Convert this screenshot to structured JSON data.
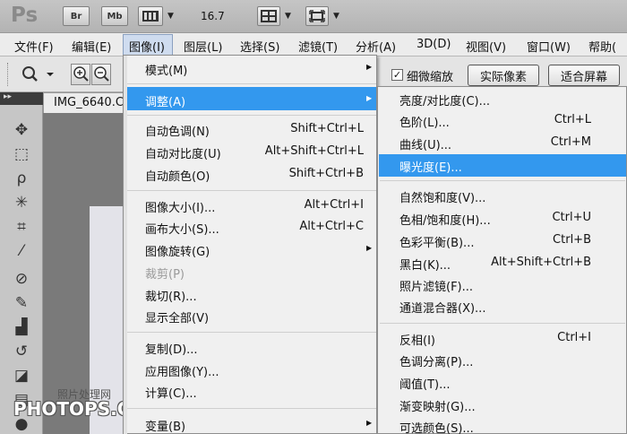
{
  "app": {
    "logo": "Ps",
    "toolbar": {
      "br": "Br",
      "mb": "Mb",
      "zoom": "16.7"
    }
  },
  "menubar": {
    "items": [
      {
        "label": "文件(F)"
      },
      {
        "label": "编辑(E)"
      },
      {
        "label": "图像(I)"
      },
      {
        "label": "图层(L)"
      },
      {
        "label": "选择(S)"
      },
      {
        "label": "滤镜(T)"
      },
      {
        "label": "分析(A)"
      },
      {
        "label": "3D(D)"
      },
      {
        "label": "视图(V)"
      },
      {
        "label": "窗口(W)"
      },
      {
        "label": "帮助("
      }
    ]
  },
  "options": {
    "scrubby_zoom": "细微缩放",
    "actual_pixels": "实际像素",
    "fit_screen": "适合屏幕",
    "checked": "✓"
  },
  "document": {
    "tab": "IMG_6640.C"
  },
  "image_menu": {
    "items": [
      {
        "label": "模式(M)",
        "shortcut": ""
      },
      {
        "label": "调整(A)",
        "shortcut": ""
      },
      {
        "label": "自动色调(N)",
        "shortcut": "Shift+Ctrl+L"
      },
      {
        "label": "自动对比度(U)",
        "shortcut": "Alt+Shift+Ctrl+L"
      },
      {
        "label": "自动颜色(O)",
        "shortcut": "Shift+Ctrl+B"
      },
      {
        "label": "图像大小(I)...",
        "shortcut": "Alt+Ctrl+I"
      },
      {
        "label": "画布大小(S)...",
        "shortcut": "Alt+Ctrl+C"
      },
      {
        "label": "图像旋转(G)",
        "shortcut": ""
      },
      {
        "label": "裁剪(P)",
        "shortcut": ""
      },
      {
        "label": "裁切(R)...",
        "shortcut": ""
      },
      {
        "label": "显示全部(V)",
        "shortcut": ""
      },
      {
        "label": "复制(D)...",
        "shortcut": ""
      },
      {
        "label": "应用图像(Y)...",
        "shortcut": ""
      },
      {
        "label": "计算(C)...",
        "shortcut": ""
      },
      {
        "label": "变量(B)",
        "shortcut": ""
      }
    ]
  },
  "adjust_menu": {
    "items": [
      {
        "label": "亮度/对比度(C)...",
        "shortcut": ""
      },
      {
        "label": "色阶(L)...",
        "shortcut": "Ctrl+L"
      },
      {
        "label": "曲线(U)...",
        "shortcut": "Ctrl+M"
      },
      {
        "label": "曝光度(E)...",
        "shortcut": ""
      },
      {
        "label": "自然饱和度(V)...",
        "shortcut": ""
      },
      {
        "label": "色相/饱和度(H)...",
        "shortcut": "Ctrl+U"
      },
      {
        "label": "色彩平衡(B)...",
        "shortcut": "Ctrl+B"
      },
      {
        "label": "黑白(K)...",
        "shortcut": "Alt+Shift+Ctrl+B"
      },
      {
        "label": "照片滤镜(F)...",
        "shortcut": ""
      },
      {
        "label": "通道混合器(X)...",
        "shortcut": ""
      },
      {
        "label": "反相(I)",
        "shortcut": "Ctrl+I"
      },
      {
        "label": "色调分离(P)...",
        "shortcut": ""
      },
      {
        "label": "阈值(T)...",
        "shortcut": ""
      },
      {
        "label": "渐变映射(G)...",
        "shortcut": ""
      },
      {
        "label": "可选颜色(S)...",
        "shortcut": ""
      }
    ]
  },
  "watermark": {
    "line1": "照片处理网",
    "line2": "PHOTOPS.COM"
  },
  "colors": {
    "highlight": "#3398ee",
    "menubar": "#ececec"
  }
}
